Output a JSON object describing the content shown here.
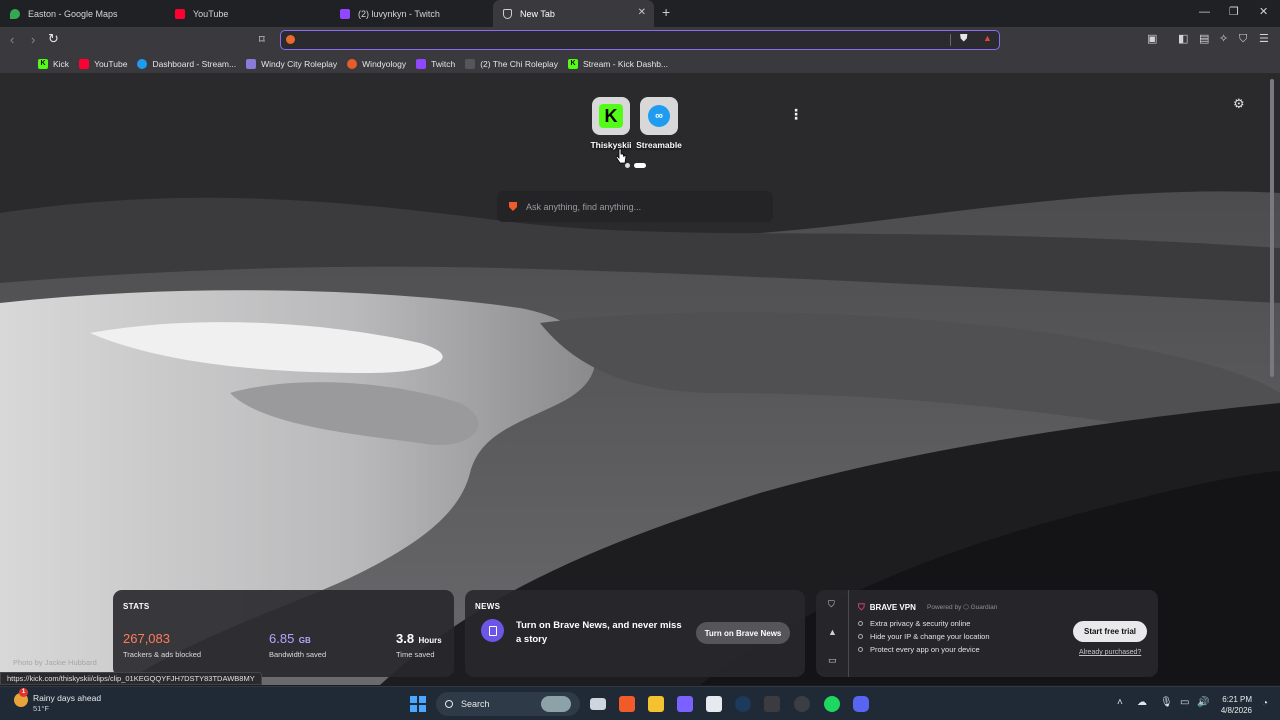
{
  "tabs": [
    {
      "title": "Easton - Google Maps",
      "icon": "google-maps-icon"
    },
    {
      "title": "YouTube",
      "icon": "youtube-icon"
    },
    {
      "title": "(2) luvynkyn - Twitch",
      "icon": "twitch-icon"
    },
    {
      "title": "New Tab",
      "icon": "brave-shield-icon",
      "active": true
    }
  ],
  "window_controls": {
    "minimize": "—",
    "restore": "❐",
    "close": "✕",
    "new_tab": "+"
  },
  "omnibox": {
    "value": "",
    "placeholder": ""
  },
  "bookmarks": [
    {
      "label": "Kick",
      "icon": "kick-icon",
      "color": "#53fc18"
    },
    {
      "label": "YouTube",
      "icon": "youtube-icon",
      "color": "#ff0033"
    },
    {
      "label": "Dashboard - Stream...",
      "icon": "streamable-icon",
      "color": "#1f9cf0"
    },
    {
      "label": "Windy City Roleplay",
      "icon": "windy-city-icon",
      "color": "#8a7bd8"
    },
    {
      "label": "Windyology",
      "icon": "windyology-icon",
      "color": "#e85c2b"
    },
    {
      "label": "Twitch",
      "icon": "twitch-icon",
      "color": "#9146ff"
    },
    {
      "label": "(2) The Chi Roleplay",
      "icon": "chi-roleplay-icon",
      "color": "#3a3a3e"
    },
    {
      "label": "Stream - Kick Dashb...",
      "icon": "kick-icon",
      "color": "#53fc18"
    }
  ],
  "top_sites": [
    {
      "label": "Thiskyskii",
      "icon": "kick-icon",
      "color": "#53fc18"
    },
    {
      "label": "Streamable",
      "icon": "streamable-icon",
      "color": "#1f9cf0"
    }
  ],
  "new_tab_search": {
    "placeholder": "Ask anything, find anything..."
  },
  "photo_credit": "Photo by Jackie Hubbard",
  "stats": {
    "heading": "STATS",
    "trackers": {
      "value": "267,083",
      "caption": "Trackers & ads blocked",
      "color": "#ff7a5c"
    },
    "bandwidth": {
      "value": "6.85",
      "unit": "GB",
      "caption": "Bandwidth saved",
      "color": "#b3a6ff"
    },
    "time": {
      "value": "3.8",
      "unit": "Hours",
      "caption": "Time saved",
      "color": "#ffffff"
    }
  },
  "news": {
    "heading": "NEWS",
    "text": "Turn on Brave News, and never miss a story",
    "button": "Turn on Brave News"
  },
  "vpn": {
    "title": "BRAVE VPN",
    "powered_by": "Powered by ⬡ Guardian",
    "features": [
      "Extra privacy & security online",
      "Hide your IP & change your location",
      "Protect every app on your device"
    ],
    "button": "Start free trial",
    "link": "Already purchased?"
  },
  "status_url": "https://kick.com/thiskyskii/clips/clip_01KEGQQYFJH7DSTY83TDAWB8MY",
  "taskbar": {
    "weather_title": "Rainy days ahead",
    "weather_temp": "51°F",
    "weather_badge": "1",
    "search_label": "Search",
    "time": "6:21 PM",
    "date": "4/8/2026"
  }
}
